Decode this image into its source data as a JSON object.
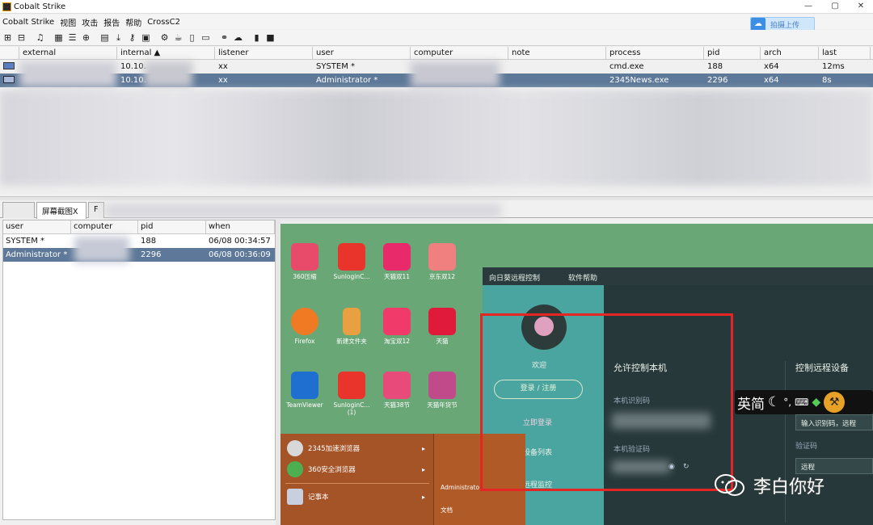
{
  "window": {
    "title": "Cobalt Strike",
    "minimize": "—",
    "maximize": "▢",
    "close": "✕"
  },
  "menu": [
    "Cobalt Strike",
    "视图",
    "攻击",
    "报告",
    "帮助",
    "CrossC2"
  ],
  "cloud_button": {
    "label": "拍摄上传",
    "icon": "cloud-icon"
  },
  "sessions": {
    "columns": [
      "external",
      "internal ▲",
      "listener",
      "user",
      "computer",
      "note",
      "process",
      "pid",
      "arch",
      "last"
    ],
    "rows": [
      {
        "external": "",
        "internal": "10.10.",
        "listener": "xx",
        "user": "SYSTEM *",
        "computer": "",
        "note": "",
        "process": "cmd.exe",
        "pid": "188",
        "arch": "x64",
        "last": "12ms"
      },
      {
        "external": "",
        "internal": "10.10.",
        "listener": "xx",
        "user": "Administrator *",
        "computer": "",
        "note": "",
        "process": "2345News.exe",
        "pid": "2296",
        "arch": "x64",
        "last": "8s"
      }
    ]
  },
  "tabs": {
    "active": "屏幕截图X",
    "next": "F"
  },
  "screenshots": {
    "columns": [
      "user",
      "computer",
      "pid",
      "when"
    ],
    "rows": [
      {
        "user": "SYSTEM *",
        "computer": "",
        "pid": "188",
        "when": "06/08 00:34:57"
      },
      {
        "user": "Administrator *",
        "computer": "",
        "pid": "2296",
        "when": "06/08 00:36:09"
      }
    ]
  },
  "desktop": {
    "icons": [
      {
        "label": "360压缩",
        "color": "#e84a6a"
      },
      {
        "label": "SunloginC...",
        "color": "#e8342a"
      },
      {
        "label": "天猫双11",
        "color": "#e82a6a"
      },
      {
        "label": "京东双12",
        "color": "#f08080"
      },
      {
        "label": "Firefox",
        "color": "#f07a24"
      },
      {
        "label": "新建文件夹",
        "color": "#e8a040"
      },
      {
        "label": "淘宝双12",
        "color": "#f03a6a"
      },
      {
        "label": "天猫",
        "color": "#e01a3a"
      },
      {
        "label": "TeamViewer",
        "color": "#1e6fd0"
      },
      {
        "label": "SunloginC...\n(1)",
        "color": "#e8342a"
      },
      {
        "label": "天猫38节",
        "color": "#e84a7a"
      },
      {
        "label": "天猫年货节",
        "color": "#c04a8a"
      }
    ],
    "panel": {
      "head_left": "向日葵远程控制",
      "head_right": "软件帮助",
      "user_name": "欢迎",
      "login_button": "登录 / 注册",
      "link1": "立即登录",
      "link2": "设备列表",
      "link3": "远程监控",
      "title_left": "允许控制本机",
      "field_id": "本机识别码",
      "field_code": "本机验证码",
      "title_right": "控制远程设备",
      "right_placeholder": "输入识别码，远程",
      "right_field": "验证码",
      "right_option": "远程"
    },
    "start_menu": {
      "items": [
        "2345加速浏览器",
        "360安全浏览器",
        "记事本"
      ],
      "user": "Administrato",
      "docs": "文档"
    },
    "ime_text": "英简",
    "watermark": "李白你好"
  }
}
